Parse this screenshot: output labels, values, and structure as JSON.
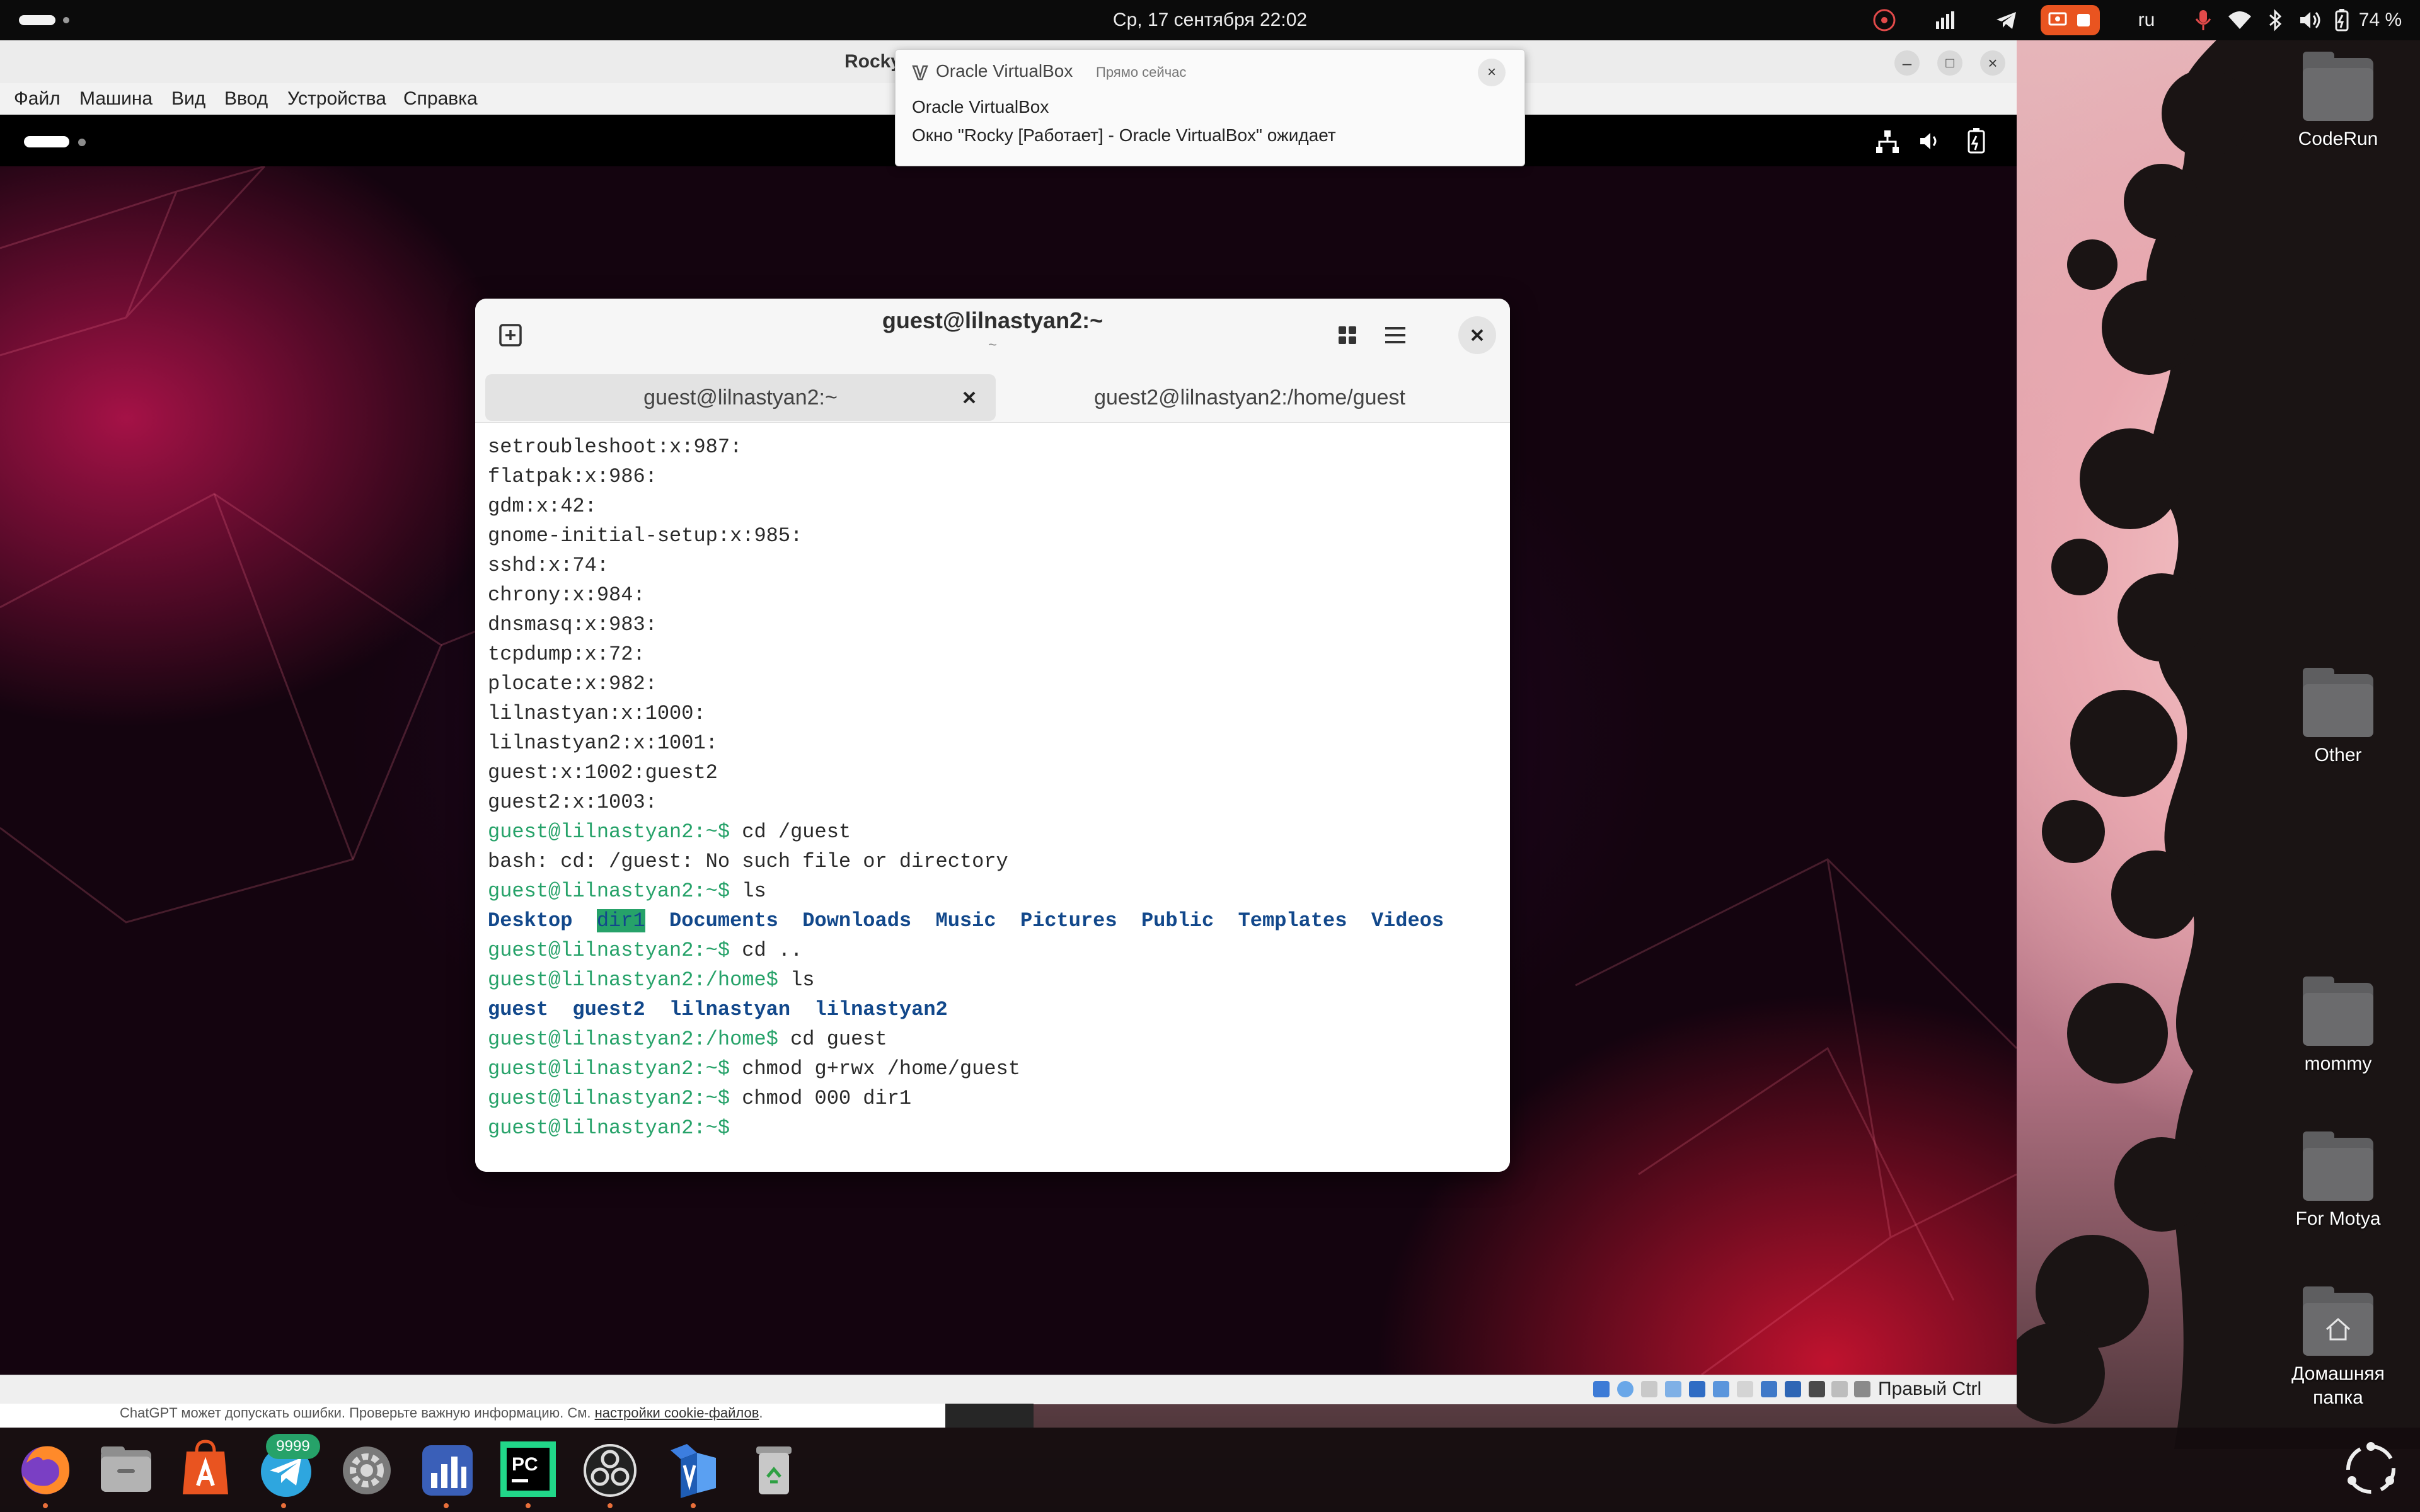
{
  "topbar": {
    "clock": "Ср, 17 сентября  22:02",
    "keyboard_layout": "ru",
    "battery": "74 %"
  },
  "vbox": {
    "title": "Rocky",
    "menu": [
      "Файл",
      "Машина",
      "Вид",
      "Ввод",
      "Устройства",
      "Справка"
    ],
    "host_key": "Правый Ctrl"
  },
  "notification": {
    "app": "Oracle VirtualBox",
    "time": "Прямо сейчас",
    "title": "Oracle VirtualBox",
    "body": "Окно \"Rocky [Работает] - Oracle VirtualBox\" ожидает",
    "close": "×"
  },
  "terminal": {
    "title": "guest@lilnastyan2:~",
    "subtitle": "~",
    "tabs": [
      {
        "label": "guest@lilnastyan2:~"
      },
      {
        "label": "guest2@lilnastyan2:/home/guest"
      }
    ],
    "lines": {
      "l1": "setroubleshoot:x:987:",
      "l2": "flatpak:x:986:",
      "l3": "gdm:x:42:",
      "l4": "gnome-initial-setup:x:985:",
      "l5": "sshd:x:74:",
      "l6": "chrony:x:984:",
      "l7": "dnsmasq:x:983:",
      "l8": "tcpdump:x:72:",
      "l9": "plocate:x:982:",
      "l10": "lilnastyan:x:1000:",
      "l11": "lilnastyan2:x:1001:",
      "l12": "guest:x:1002:guest2",
      "l13": "guest2:x:1003:",
      "p14": "guest@lilnastyan2",
      "s14": ":~$ ",
      "c14": "cd /guest",
      "l15": "bash: cd: /guest: No such file or directory",
      "p16": "guest@lilnastyan2",
      "s16": ":~$ ",
      "c16": "ls",
      "ls1": [
        "Desktop",
        "dir1",
        "Documents",
        "Downloads",
        "Music",
        "Pictures",
        "Public",
        "Templates",
        "Videos"
      ],
      "p18": "guest@lilnastyan2",
      "s18": ":~$ ",
      "c18": "cd ..",
      "p19": "guest@lilnastyan2",
      "s19": ":/home$ ",
      "c19": "ls",
      "ls2": [
        "guest",
        "guest2",
        "lilnastyan",
        "lilnastyan2"
      ],
      "p21": "guest@lilnastyan2",
      "s21": ":/home$ ",
      "c21": "cd guest",
      "p22": "guest@lilnastyan2",
      "s22": ":~$ ",
      "c22": "chmod g+rwx /home/guest",
      "p23": "guest@lilnastyan2",
      "s23": ":~$ ",
      "c23": "chmod 000 dir1",
      "p24": "guest@lilnastyan2",
      "s24": ":~$ "
    }
  },
  "browser": {
    "notice": "ChatGPT может допускать ошибки. Проверьте важную информацию. См. ",
    "link": "настройки cookie-файлов",
    "notice_end": "."
  },
  "desktop_icons": [
    {
      "label": "CodeRun"
    },
    {
      "label": "Other"
    },
    {
      "label": "mommy"
    },
    {
      "label": "For Motya"
    },
    {
      "label": "Домашняя папка"
    }
  ],
  "dock": {
    "telegram_badge": "9999",
    "apps": [
      "firefox-icon",
      "files-icon",
      "app-center-icon",
      "telegram-icon",
      "settings-icon",
      "system-monitor-icon",
      "pycharm-icon",
      "obs-icon",
      "virtualbox-icon",
      "trash-icon",
      "show-apps-icon"
    ]
  },
  "colors": {
    "prompt": "#26a269",
    "directory": "#12488b",
    "accent_orange": "#e95420"
  }
}
